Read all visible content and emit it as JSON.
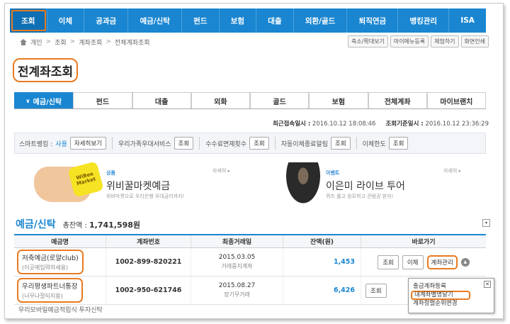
{
  "topnav": [
    "조회",
    "이체",
    "공과금",
    "예금/신탁",
    "펀드",
    "보험",
    "대출",
    "외환/골드",
    "퇴직연금",
    "뱅킹관리",
    "ISA"
  ],
  "breadcrumb": [
    "개인",
    "조회",
    "계좌조회",
    "전체계좌조회"
  ],
  "util_buttons": [
    "축소/확대보기",
    "마이메뉴등록",
    "체험하기",
    "화면인쇄"
  ],
  "page_title": "전계좌조회",
  "subtabs": [
    "예금/신탁",
    "펀드",
    "대출",
    "외화",
    "골드",
    "보험",
    "전체계좌",
    "마이브랜치"
  ],
  "login_info": {
    "last_access_label": "최근접속일시 :",
    "last_access": "2016.10.12 18:08:46",
    "query_label": "조회기준일시 :",
    "query_time": "2016.10.12 23:36:29"
  },
  "services": {
    "smart_label": "스마트뱅킹 :",
    "smart_value": "사용",
    "smart_btn": "자세히보기",
    "family_label": "우리가족우대서비스",
    "family_btn": "조회",
    "fee_label": "수수료면제횟수",
    "fee_btn": "조회",
    "auto_label": "자동이체종료알림",
    "auto_btn": "조회",
    "limit_label": "이체한도",
    "limit_btn": "조회"
  },
  "banner1": {
    "tag": "상품",
    "title": "위비꿀마켓예금",
    "sub": "위비마켓으로 우리은행 우대금리까지!",
    "more": "자세히 ▸",
    "card_text": "WiBee Market"
  },
  "banner2": {
    "tag": "이벤트",
    "title": "이은미 라이브 투어",
    "sub": "퀴즈 풀고 응모하고 관람권 받자!",
    "more": "자세히 ▸"
  },
  "accounts": {
    "title": "예금/신탁",
    "total_label": "총잔액 :",
    "total_value": "1,741,598원",
    "headers": [
      "예금명",
      "계좌번호",
      "최종거래일",
      "잔액(원)",
      "바로가기"
    ],
    "rows": [
      {
        "name": "저축예금(로얄club)",
        "sub": "(이곳에입력하세용)",
        "number": "1002-899-820221",
        "date": "2015.03.05",
        "note": "거래중지계좌",
        "balance": "1,453"
      },
      {
        "name": "우리평생파트너통장",
        "sub": "(너무나잘되지용)",
        "number": "1002-950-621746",
        "date": "2015.08.27",
        "note": "장기무거래",
        "balance": "6,426"
      }
    ],
    "partial_row": "우리모바일예금적립식 투자신탁",
    "go_buttons": [
      "조회",
      "이체",
      "계좌관리"
    ]
  },
  "popup": {
    "items": [
      "출금계좌등록",
      "내계좌별명달기",
      "계좌정렬순위변경"
    ],
    "close": "✕"
  }
}
